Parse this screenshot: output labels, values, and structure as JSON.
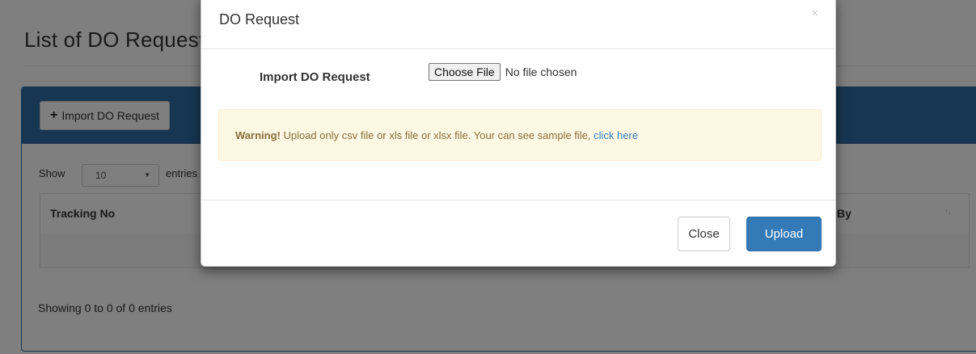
{
  "page": {
    "title": "List of DO Requests",
    "import_button_label": "Import DO Request",
    "show_label": "Show",
    "entries_value": "10",
    "entries_label": "entries",
    "columns": [
      "Tracking No",
      "By"
    ],
    "showing_text": "Showing 0 to 0 of 0 entries"
  },
  "modal": {
    "title": "DO Request",
    "close_icon": "×",
    "import_label": "Import DO Request",
    "choose_file_label": "Choose File",
    "file_status": "No file chosen",
    "warning_strong": "Warning!",
    "warning_text": " Upload only csv file or xls file or xlsx file. Your can see sample file, ",
    "warning_link": "click here",
    "close_button": "Close",
    "upload_button": "Upload"
  },
  "colors": {
    "primary": "#337ab7",
    "panel_heading": "#2e6da4",
    "warning_bg": "#fcf8e3",
    "warning_text": "#8a6d3b"
  },
  "icons": {
    "plus": "plus-icon",
    "sort": "sort-icon",
    "select_arrow": "chevron-down-icon",
    "close": "close-icon"
  }
}
